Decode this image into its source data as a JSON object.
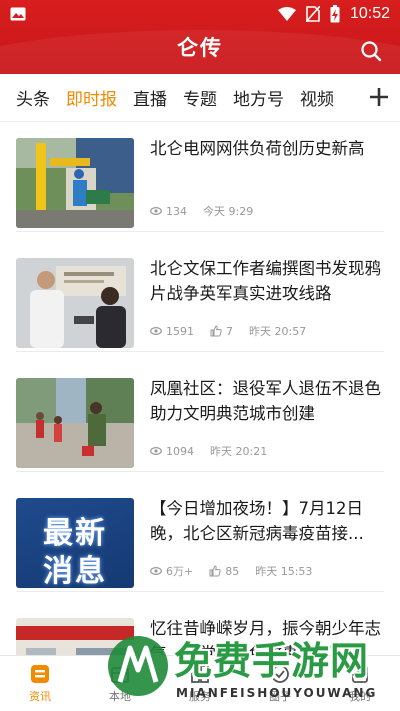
{
  "status": {
    "time": "10:52"
  },
  "app": {
    "title": "仑传"
  },
  "tabs": [
    "头条",
    "即时报",
    "直播",
    "专题",
    "地方号",
    "视频"
  ],
  "active_tab": 1,
  "articles": [
    {
      "title": "北仑电网网供负荷创历史新高",
      "views": "134",
      "likes": "",
      "time": "今天 9:29"
    },
    {
      "title": "北仑文保工作者编撰图书发现鸦片战争英军真实进攻线路",
      "views": "1591",
      "likes": "7",
      "time": "昨天 20:57"
    },
    {
      "title": "凤凰社区：退役军人退伍不退色 助力文明典范城市创建",
      "views": "1094",
      "likes": "",
      "time": "昨天 20:21"
    },
    {
      "title": "【今日增加夜场！】7月12日晚，北仑区新冠病毒疫苗接...",
      "views": "6万+",
      "likes": "85",
      "time": "昨天 15:53"
    },
    {
      "title": "忆往昔峥嵘岁月，振今朝少年志气，老党员红色故事分享",
      "views": "",
      "likes": "",
      "time": ""
    }
  ],
  "thumb4": {
    "line1": "最新",
    "line2": "消息"
  },
  "bottom_nav": [
    {
      "label": "资讯"
    },
    {
      "label": "本地"
    },
    {
      "label": "服务"
    },
    {
      "label": "圈子"
    },
    {
      "label": "我的"
    }
  ],
  "watermark": {
    "cn": "免费手游网",
    "en": "MIANFEISHOUYOUWANG"
  },
  "colors": {
    "brand_red": "#d81e1e",
    "accent_orange": "#f08a00"
  }
}
